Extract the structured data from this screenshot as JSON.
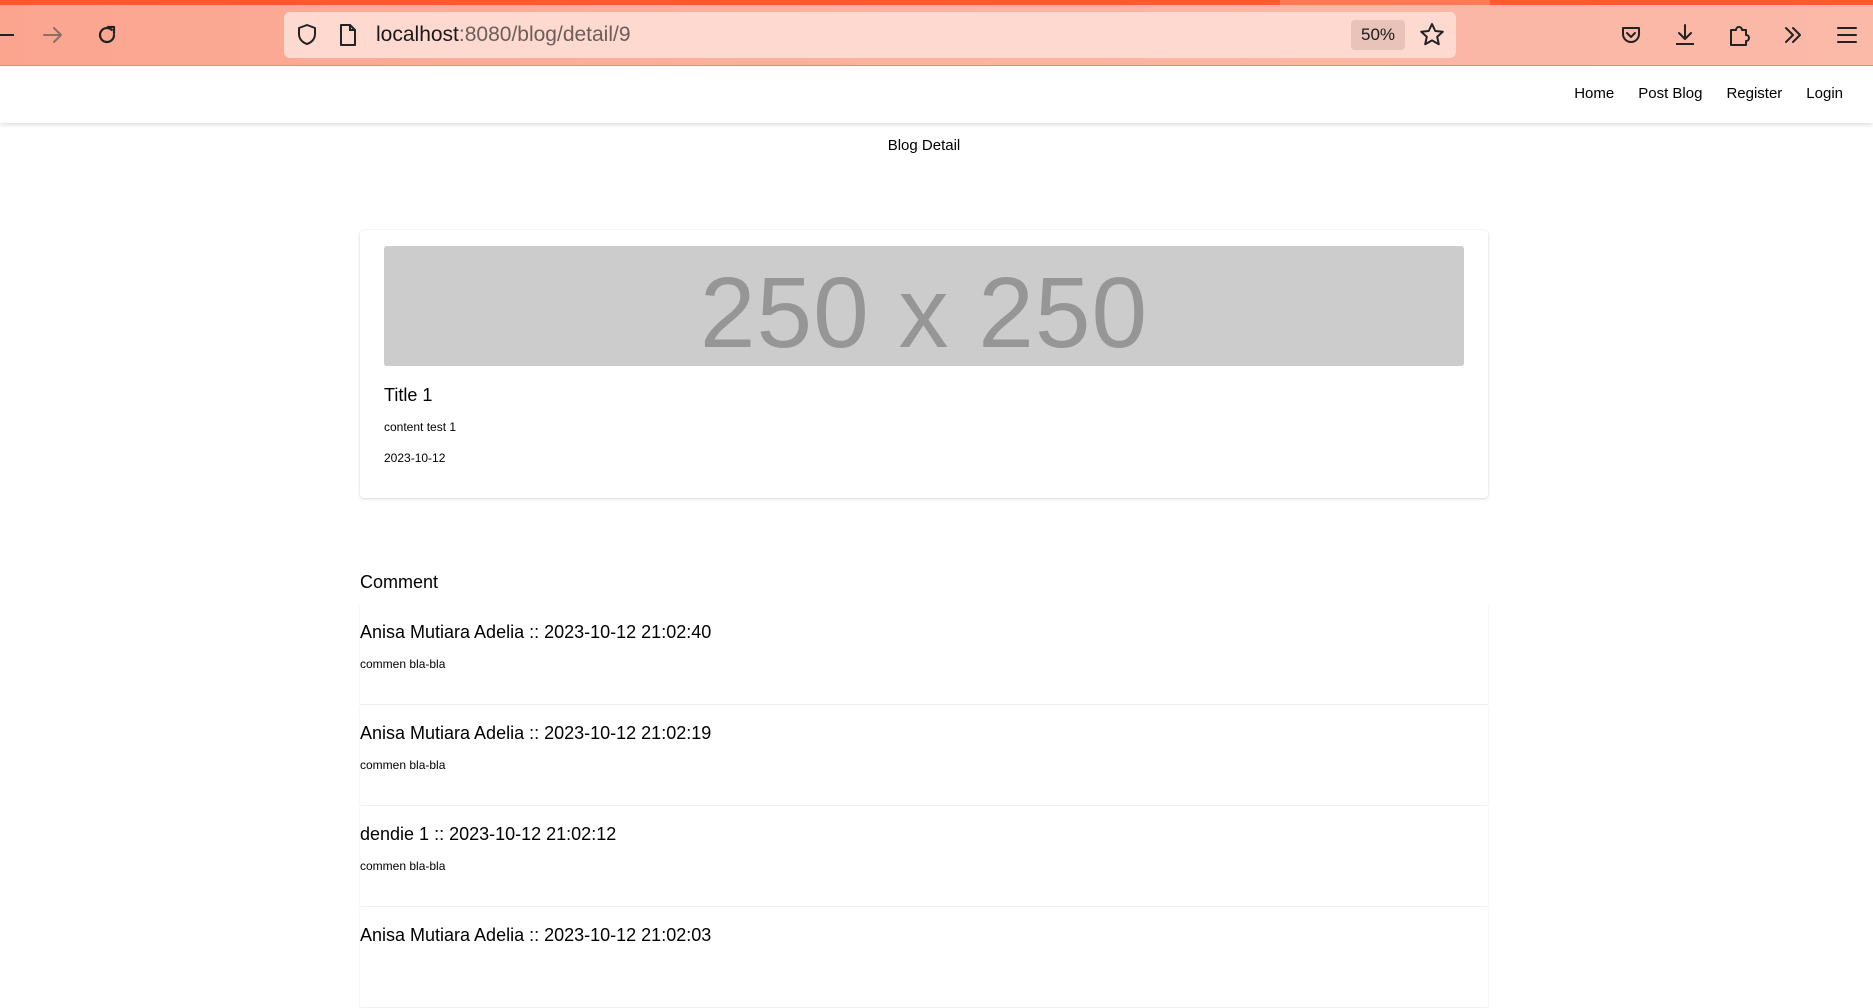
{
  "browser": {
    "url_host": "localhost",
    "url_path": ":8080/blog/detail/9",
    "zoom": "50%",
    "accent_color": "#ff5a2e"
  },
  "navbar": {
    "links": [
      "Home",
      "Post Blog",
      "Register",
      "Login"
    ]
  },
  "page": {
    "heading": "Blog Detail"
  },
  "blog": {
    "image_placeholder": "250 x 250",
    "title": "Title 1",
    "content": "content test 1",
    "date": "2023-10-12"
  },
  "comments_section": {
    "heading": "Comment",
    "items": [
      {
        "header": "Anisa Mutiara Adelia :: 2023-10-12 21:02:40",
        "body": "commen bla-bla"
      },
      {
        "header": "Anisa Mutiara Adelia :: 2023-10-12 21:02:19",
        "body": "commen bla-bla"
      },
      {
        "header": "dendie 1 :: 2023-10-12 21:02:12",
        "body": "commen bla-bla"
      },
      {
        "header": "Anisa Mutiara Adelia :: 2023-10-12 21:02:03",
        "body": ""
      }
    ]
  }
}
